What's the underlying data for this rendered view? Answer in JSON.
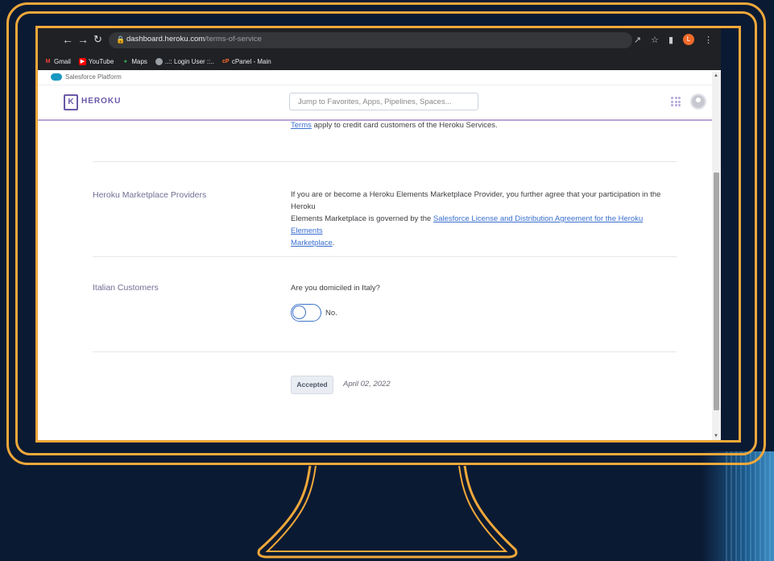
{
  "browser": {
    "url_host": "dashboard.heroku.com",
    "url_path": "/terms-of-service",
    "profile_initial": "L",
    "bookmarks": [
      {
        "label": "Gmail",
        "icon": "gmail-icon",
        "color": "#ea4335"
      },
      {
        "label": "YouTube",
        "icon": "youtube-icon",
        "color": "#ff0000"
      },
      {
        "label": "Maps",
        "icon": "maps-icon",
        "color": "#34a853"
      },
      {
        "label": "..:: Login User ::..",
        "icon": "globe-icon",
        "color": "#9aa0a6"
      },
      {
        "label": "cPanel - Main",
        "icon": "cpanel-icon",
        "color": "#ff6c2c"
      }
    ]
  },
  "salesforce_bar": {
    "label": "Salesforce Platform"
  },
  "header": {
    "brand": "HEROKU",
    "search_placeholder": "Jump to Favorites, Apps, Pipelines, Spaces..."
  },
  "terms": {
    "top_link": "Terms",
    "top_text": " apply to credit card customers of the Heroku Services."
  },
  "marketplace": {
    "label": "Heroku Marketplace Providers",
    "text_line1": "If you are or become a Heroku Elements Marketplace Provider, you further agree that your participation in the Heroku",
    "text_line2_prefix": "Elements Marketplace is governed by the ",
    "link_part1": "Salesforce License and Distribution Agreement for the Heroku Elements",
    "link_part2": "Marketplace",
    "text_suffix": "."
  },
  "italian": {
    "label": "Italian Customers",
    "question": "Are you domiciled in Italy?",
    "toggle_label": "No."
  },
  "acceptance": {
    "button": "Accepted",
    "date": "April 02, 2022"
  },
  "colors": {
    "frame": "#f0a83a",
    "heroku_purple": "#6a58a8",
    "link": "#3a6fcf"
  }
}
